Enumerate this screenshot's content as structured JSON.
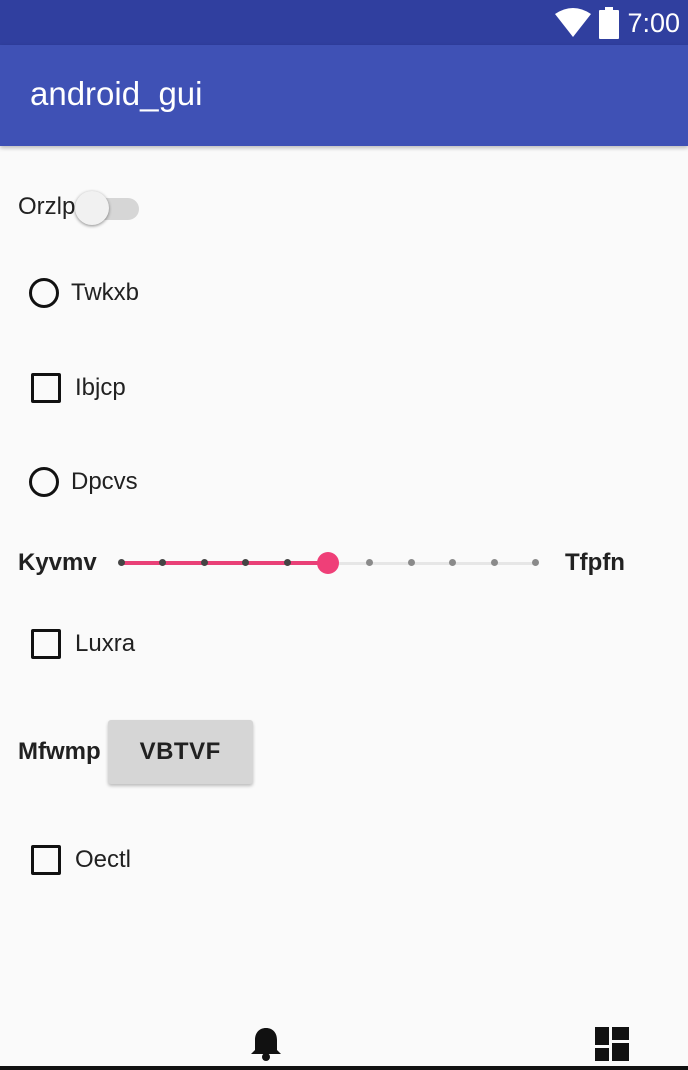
{
  "status_bar": {
    "time": "7:00"
  },
  "app_bar": {
    "title": "android_gui"
  },
  "form": {
    "switch_label": "Orzlp",
    "switch_on": false,
    "radio_1_label": "Twkxb",
    "checkbox_1_label": "Ibjcp",
    "radio_2_label": "Dpcvs",
    "slider": {
      "min_label": "Kyvmv",
      "max_label": "Tfpfn",
      "steps": 10,
      "value": 5
    },
    "checkbox_2_label": "Luxra",
    "button_row_label": "Mfwmp",
    "button_label": "VBTVF",
    "checkbox_3_label": "Oectl"
  },
  "colors": {
    "status_bar": "#303f9f",
    "app_bar": "#3f51b5",
    "accent": "#ef3f78"
  },
  "bottom_nav": {
    "left_icon": "bell-icon",
    "right_icon": "dashboard-icon"
  }
}
